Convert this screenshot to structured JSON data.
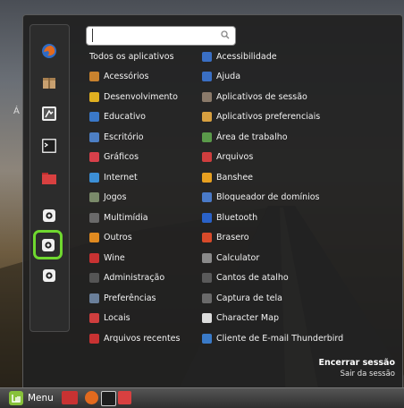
{
  "desktop": {
    "label": "Á"
  },
  "search": {
    "value": "",
    "placeholder": ""
  },
  "categories": [
    {
      "label": "Todos os aplicativos",
      "icon": "none",
      "color": ""
    },
    {
      "label": "Acessórios",
      "icon": "accessories-icon",
      "color": "#c8822e"
    },
    {
      "label": "Desenvolvimento",
      "icon": "development-icon",
      "color": "#e0b020"
    },
    {
      "label": "Educativo",
      "icon": "education-icon",
      "color": "#3a78c8"
    },
    {
      "label": "Escritório",
      "icon": "office-icon",
      "color": "#4d7fc4"
    },
    {
      "label": "Gráficos",
      "icon": "graphics-icon",
      "color": "#d8404a"
    },
    {
      "label": "Internet",
      "icon": "internet-icon",
      "color": "#3c8fd6"
    },
    {
      "label": "Jogos",
      "icon": "games-icon",
      "color": "#7a8a6a"
    },
    {
      "label": "Multimídia",
      "icon": "multimedia-icon",
      "color": "#6a6a6a"
    },
    {
      "label": "Outros",
      "icon": "others-icon",
      "color": "#e08a20"
    },
    {
      "label": "Wine",
      "icon": "wine-icon",
      "color": "#c83232"
    },
    {
      "label": "Administração",
      "icon": "administration-icon",
      "color": "#555555"
    },
    {
      "label": "Preferências",
      "icon": "preferences-icon",
      "color": "#6a7f9a"
    },
    {
      "label": "Locais",
      "icon": "places-icon",
      "color": "#cf3e3e"
    },
    {
      "label": "Arquivos recentes",
      "icon": "recent-files-icon",
      "color": "#c83232"
    }
  ],
  "apps": [
    {
      "label": "Acessibilidade",
      "icon": "accessibility-icon",
      "color": "#3a6fc4"
    },
    {
      "label": "Ajuda",
      "icon": "help-icon",
      "color": "#3a6fc4"
    },
    {
      "label": "Aplicativos de sessão",
      "icon": "session-apps-icon",
      "color": "#8a7a6a"
    },
    {
      "label": "Aplicativos preferenciais",
      "icon": "preferred-apps-icon",
      "color": "#d8a040"
    },
    {
      "label": "Área de trabalho",
      "icon": "desktop-icon",
      "color": "#5a9a4a"
    },
    {
      "label": "Arquivos",
      "icon": "files-icon",
      "color": "#cf3e3e"
    },
    {
      "label": "Banshee",
      "icon": "banshee-icon",
      "color": "#e8a020"
    },
    {
      "label": "Bloqueador de domínios",
      "icon": "domain-blocker-icon",
      "color": "#4a7ac8"
    },
    {
      "label": "Bluetooth",
      "icon": "bluetooth-icon",
      "color": "#2a62c8"
    },
    {
      "label": "Brasero",
      "icon": "brasero-icon",
      "color": "#d84a2a"
    },
    {
      "label": "Calculator",
      "icon": "calculator-icon",
      "color": "#8a8a8a"
    },
    {
      "label": "Cantos de atalho",
      "icon": "hot-corners-icon",
      "color": "#5a5a5a"
    },
    {
      "label": "Captura de tela",
      "icon": "screenshot-icon",
      "color": "#6a6a6a"
    },
    {
      "label": "Character Map",
      "icon": "character-map-icon",
      "color": "#dddddd"
    },
    {
      "label": "Cliente de E-mail Thunderbird",
      "icon": "thunderbird-icon",
      "color": "#3a7ac8"
    }
  ],
  "favorites": [
    {
      "name": "firefox-icon",
      "color": "#e36a1e"
    },
    {
      "name": "package-icon",
      "color": "#c8a070"
    },
    {
      "name": "settings-icon",
      "color": "#777777"
    },
    {
      "name": "terminal-icon",
      "color": "#222222"
    },
    {
      "name": "folder-icon",
      "color": "#cf3e3e"
    },
    {
      "name": "lock-screen-icon",
      "color": "#eeeeee"
    },
    {
      "name": "logout-icon",
      "color": "#eeeeee"
    },
    {
      "name": "shutdown-icon",
      "color": "#eeeeee"
    }
  ],
  "session": {
    "title": "Encerrar sessão",
    "subtitle": "Sair da sessão"
  },
  "taskbar": {
    "menu_label": "Menu"
  },
  "colors": {
    "accent": "#6fd82f",
    "mint": "#87c13a"
  }
}
